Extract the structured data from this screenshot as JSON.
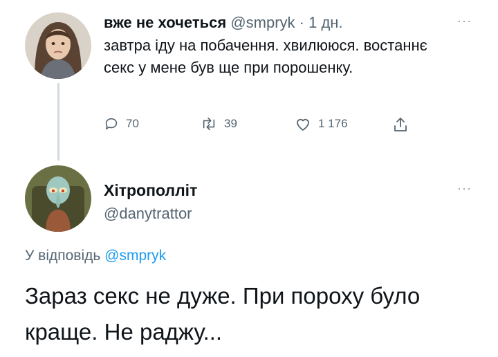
{
  "tweet": {
    "author_name": "вже не хочеться",
    "author_handle": "@smpryk",
    "separator": " · ",
    "time": "1 дн.",
    "more": "···",
    "text": "завтра іду на побачення. хвилююся. востаннє секс у мене був ще при порошенку.",
    "replies": "70",
    "retweets": "39",
    "likes": "1 176"
  },
  "reply": {
    "author_name": "Хітрополліт",
    "author_handle": "@danytrattor",
    "more": "···",
    "replying_to_prefix": "У відповідь ",
    "replying_to_handle": "@smpryk",
    "text": "Зараз секс не дуже. При пороху було краще. Не раджу..."
  },
  "icons": {
    "reply": "comment-icon",
    "retweet": "retweet-icon",
    "like": "heart-icon",
    "share": "share-icon"
  },
  "colors": {
    "text": "#0f1419",
    "muted": "#536471",
    "link": "#1d9bf0",
    "thread_line": "#cfd9de"
  }
}
